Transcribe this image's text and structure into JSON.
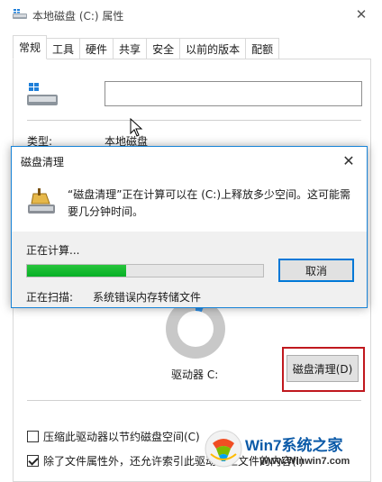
{
  "window": {
    "title": "本地磁盘 (C:) 属性",
    "close_glyph": "✕"
  },
  "tabs": [
    {
      "label": "常规",
      "active": true
    },
    {
      "label": "工具"
    },
    {
      "label": "硬件"
    },
    {
      "label": "共享"
    },
    {
      "label": "安全"
    },
    {
      "label": "以前的版本"
    },
    {
      "label": "配额"
    }
  ],
  "general": {
    "name_value": "",
    "type_label": "类型:",
    "type_value": "本地磁盘",
    "drive_label": "驱动器 C:",
    "cleanup_button": "磁盘清理(D)",
    "compress_option": "压缩此驱动器以节约磁盘空间(C)",
    "compress_checked": false,
    "index_option": "除了文件属性外，还允许索引此驱动器上文件的内容(I)",
    "index_checked": true
  },
  "dialog": {
    "title": "磁盘清理",
    "close_glyph": "✕",
    "message": "“磁盘清理”正在计算可以在 (C:)上释放多少空间。这可能需要几分钟时间。",
    "calculating_label": "正在计算...",
    "progress_fraction": 0.42,
    "cancel_button": "取消",
    "scanning_label": "正在扫描:",
    "scanning_value": "系统错误内存转储文件"
  },
  "watermark": {
    "brand": "Win7系统之家",
    "url": "Www.Winwin7.com"
  },
  "colors": {
    "accent": "#1883d7",
    "progress_green": "#06b025",
    "highlight_red": "#c0181e"
  }
}
